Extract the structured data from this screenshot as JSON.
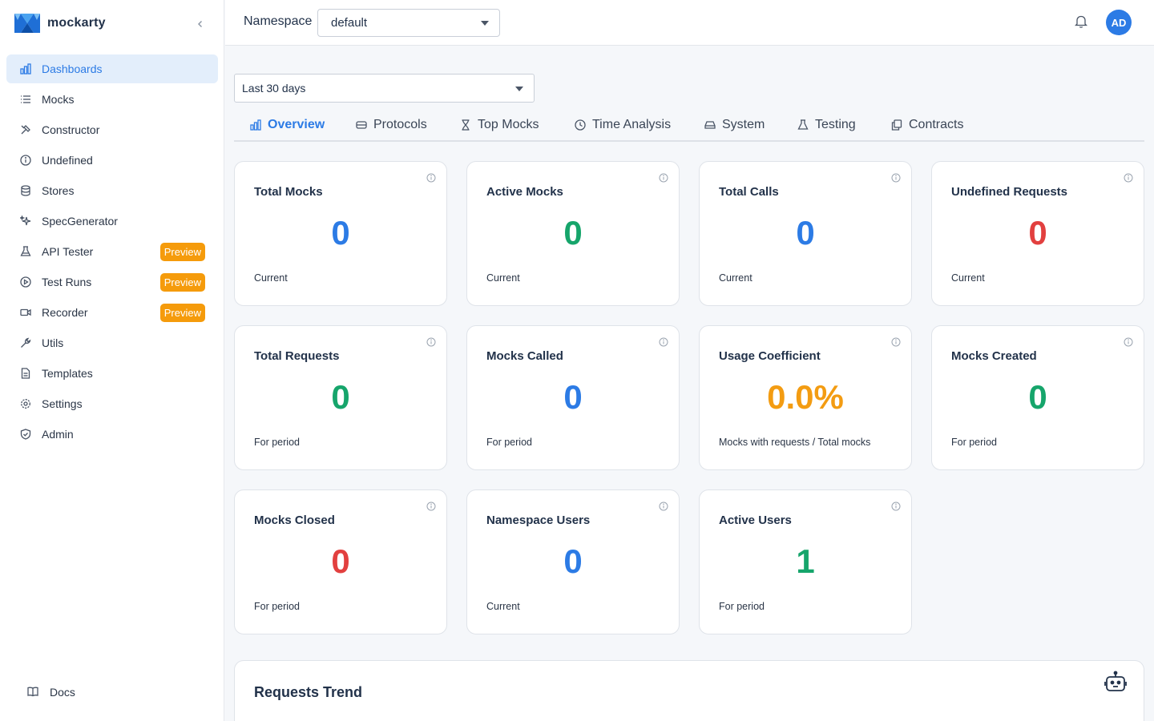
{
  "brand": {
    "name": "mockarty",
    "logo_icon": "mockarty-logo-icon"
  },
  "sidebar": {
    "items": [
      {
        "label": "Dashboards",
        "icon": "bar-chart-icon",
        "active": true
      },
      {
        "label": "Mocks",
        "icon": "list-icon"
      },
      {
        "label": "Constructor",
        "icon": "tools-icon"
      },
      {
        "label": "Undefined",
        "icon": "info-circle-icon"
      },
      {
        "label": "Stores",
        "icon": "database-icon"
      },
      {
        "label": "SpecGenerator",
        "icon": "sparkle-icon"
      },
      {
        "label": "API Tester",
        "icon": "flask-icon",
        "badge": "Preview"
      },
      {
        "label": "Test Runs",
        "icon": "play-circle-icon",
        "badge": "Preview"
      },
      {
        "label": "Recorder",
        "icon": "video-icon",
        "badge": "Preview"
      },
      {
        "label": "Utils",
        "icon": "wrench-icon"
      },
      {
        "label": "Templates",
        "icon": "file-icon"
      },
      {
        "label": "Settings",
        "icon": "gear-icon"
      },
      {
        "label": "Admin",
        "icon": "shield-icon"
      }
    ],
    "docs_label": "Docs"
  },
  "header": {
    "namespace_label": "Namespace",
    "namespace_value": "default",
    "avatar_initials": "AD"
  },
  "period": {
    "value": "Last 30 days"
  },
  "tabs": [
    {
      "label": "Overview",
      "icon": "bar-chart-icon",
      "active": true
    },
    {
      "label": "Protocols",
      "icon": "server-icon"
    },
    {
      "label": "Top Mocks",
      "icon": "hourglass-icon"
    },
    {
      "label": "Time Analysis",
      "icon": "clock-icon"
    },
    {
      "label": "System",
      "icon": "hard-drive-icon"
    },
    {
      "label": "Testing",
      "icon": "flask-icon"
    },
    {
      "label": "Contracts",
      "icon": "copy-icon"
    }
  ],
  "cards": [
    {
      "title": "Total Mocks",
      "value": "0",
      "sub": "Current",
      "color": "#2c7be5"
    },
    {
      "title": "Active Mocks",
      "value": "0",
      "sub": "Current",
      "color": "#16a56b"
    },
    {
      "title": "Total Calls",
      "value": "0",
      "sub": "Current",
      "color": "#2c7be5"
    },
    {
      "title": "Undefined Requests",
      "value": "0",
      "sub": "Current",
      "color": "#e2403f"
    },
    {
      "title": "Total Requests",
      "value": "0",
      "sub": "For period",
      "color": "#16a56b"
    },
    {
      "title": "Mocks Called",
      "value": "0",
      "sub": "For period",
      "color": "#2c7be5"
    },
    {
      "title": "Usage Coefficient",
      "value": "0.0%",
      "sub": "Mocks with requests / Total mocks",
      "color": "#f39c12"
    },
    {
      "title": "Mocks Created",
      "value": "0",
      "sub": "For period",
      "color": "#16a56b"
    },
    {
      "title": "Mocks Closed",
      "value": "0",
      "sub": "For period",
      "color": "#e2403f"
    },
    {
      "title": "Namespace Users",
      "value": "0",
      "sub": "Current",
      "color": "#2c7be5"
    },
    {
      "title": "Active Users",
      "value": "1",
      "sub": "For period",
      "color": "#16a56b"
    }
  ],
  "trend": {
    "title": "Requests Trend"
  },
  "colors": {
    "accent": "#2c7be5",
    "badge": "#f59b0b",
    "active_bg": "#e3eefb"
  }
}
